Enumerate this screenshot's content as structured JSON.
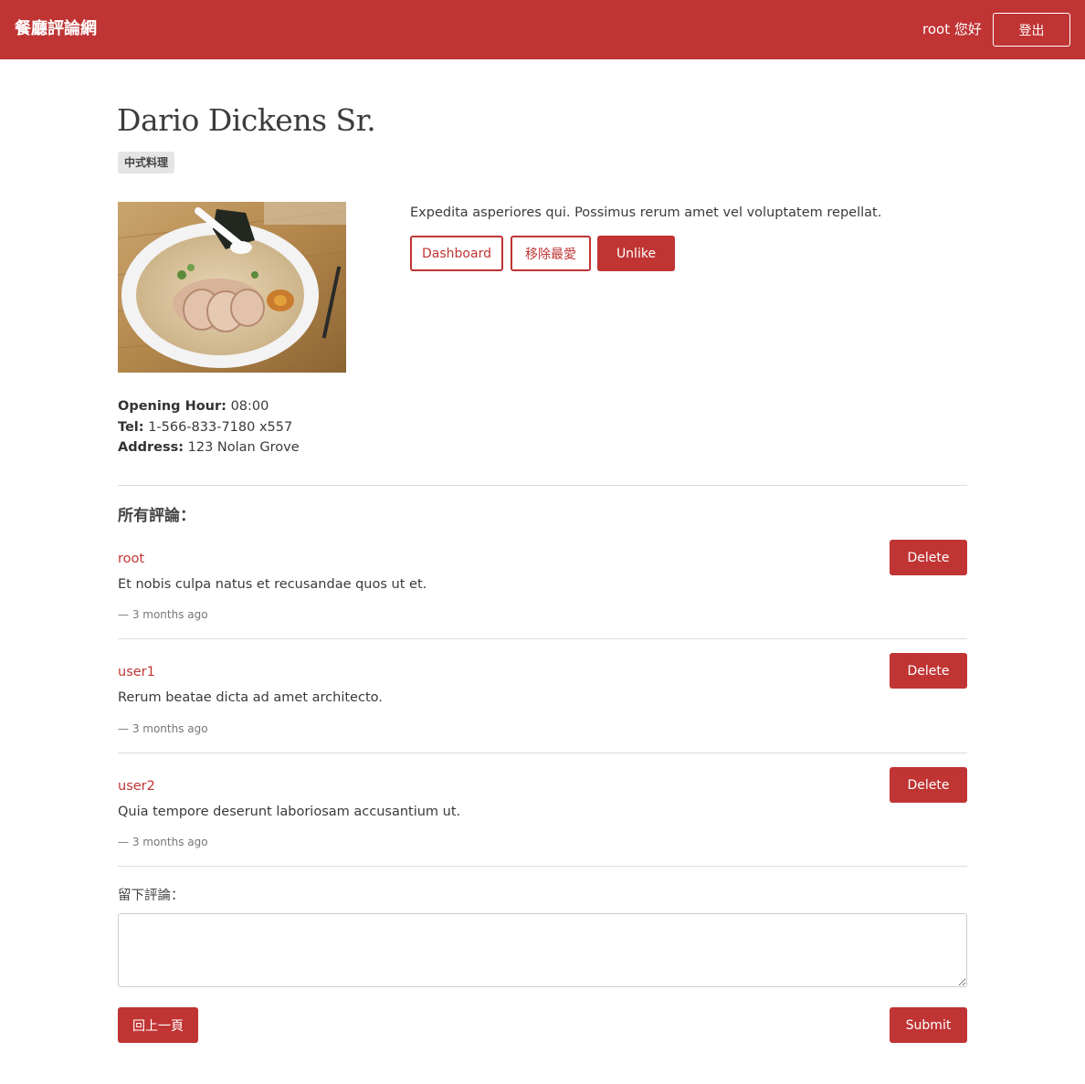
{
  "navbar": {
    "brand": "餐廳評論網",
    "greeting": "root 您好",
    "logout_label": "登出"
  },
  "restaurant": {
    "name": "Dario Dickens Sr.",
    "category": "中式料理",
    "description": "Expedita asperiores qui. Possimus rerum amet vel voluptatem repellat.",
    "opening_hour_label": "Opening Hour:",
    "opening_hour": "08:00",
    "tel_label": "Tel:",
    "tel": "1-566-833-7180 x557",
    "address_label": "Address:",
    "address": "123 Nolan Grove"
  },
  "actions": {
    "dashboard_label": "Dashboard",
    "favorite_label": "移除最愛",
    "like_label": "Unlike"
  },
  "comments_section": {
    "heading": "所有評論：",
    "delete_label": "Delete",
    "items": [
      {
        "user": "root",
        "text": "Et nobis culpa natus et recusandae quos ut et.",
        "time": "—  3 months ago"
      },
      {
        "user": "user1",
        "text": "Rerum beatae dicta ad amet architecto.",
        "time": "—  3 months ago"
      },
      {
        "user": "user2",
        "text": "Quia tempore deserunt laboriosam accusantium ut.",
        "time": "—  3 months ago"
      }
    ]
  },
  "new_comment": {
    "label": "留下評論：",
    "value": "",
    "back_label": "回上一頁",
    "submit_label": "Submit"
  },
  "colors": {
    "brand": "#c03434",
    "divider": "#dddddd"
  }
}
